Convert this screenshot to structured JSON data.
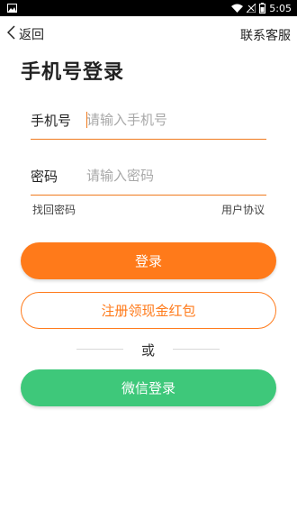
{
  "status_bar": {
    "time": "5:05",
    "icons": [
      "image-icon",
      "wifi-icon",
      "no-signal-icon",
      "battery-icon"
    ]
  },
  "header": {
    "back_label": "返回",
    "contact_label": "联系客服"
  },
  "page": {
    "title": "手机号登录"
  },
  "form": {
    "phone": {
      "label": "手机号",
      "placeholder": "请输入手机号",
      "value": ""
    },
    "password": {
      "label": "密码",
      "placeholder": "请输入密码",
      "value": ""
    },
    "forgot_label": "找回密码",
    "agreement_label": "用户协议"
  },
  "actions": {
    "login_label": "登录",
    "register_label": "注册领现金红包",
    "or_label": "或",
    "wechat_label": "微信登录"
  },
  "colors": {
    "accent": "#ff7a1a",
    "wechat": "#3ec87a"
  }
}
